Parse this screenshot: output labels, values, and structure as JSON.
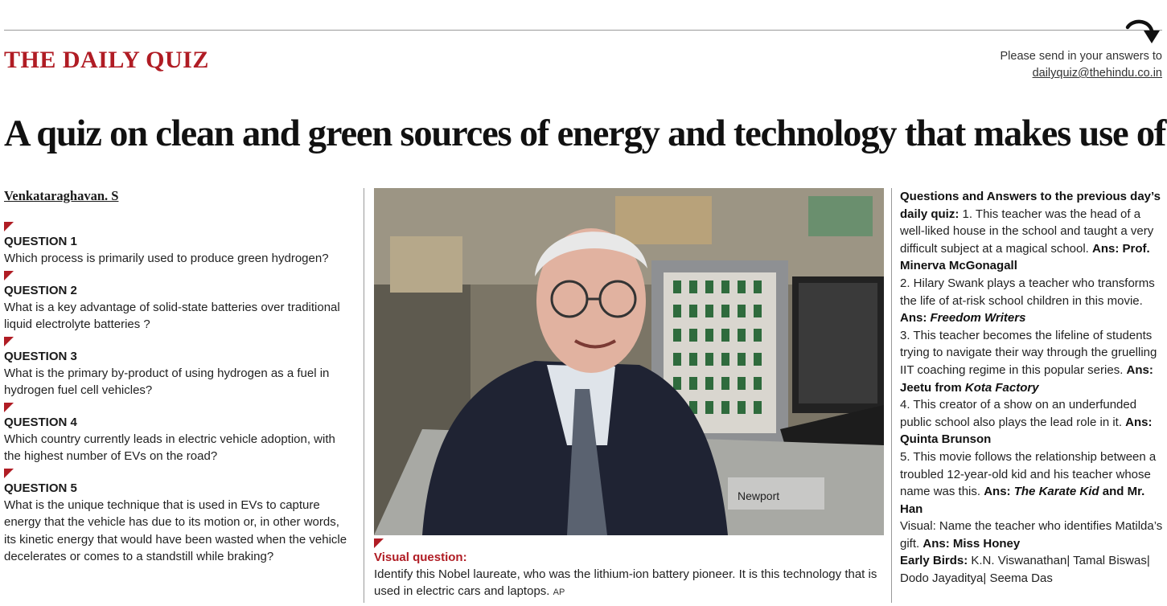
{
  "header": {
    "section_title": "THE DAILY QUIZ",
    "send_note": "Please send in your answers to",
    "email": "dailyquiz@thehindu.co.in"
  },
  "headline": "A quiz on clean and green sources of energy and technology that makes use of it",
  "byline": "Venkataraghavan. S",
  "questions": [
    {
      "label": "QUESTION 1",
      "text": "Which process is primarily used to produce green hydrogen?"
    },
    {
      "label": "QUESTION 2",
      "text": "What is a key advantage of solid-state batteries over traditional liquid electrolyte batteries ?"
    },
    {
      "label": "QUESTION 3",
      "text": "What is the primary by-product of using hydrogen as a fuel in hydrogen fuel cell vehicles?"
    },
    {
      "label": "QUESTION 4",
      "text": "Which country currently leads in electric vehicle adoption, with the highest number of EVs on the road?"
    },
    {
      "label": "QUESTION 5",
      "text": "What is the unique technique that is used in EVs to capture energy that the vehicle has due to its motion or, in other words, its kinetic energy that would have been wasted when the vehicle decelerates or comes to a standstill while braking?"
    }
  ],
  "visual": {
    "label": "Visual question:",
    "text": "Identify this Nobel laureate, who was the lithium-ion battery pioneer. It is this technology that is used in electric cars and laptops.",
    "credit": "AP",
    "photo_text": "Newport"
  },
  "answers": {
    "intro": "Questions and Answers to the previous day’s daily quiz:",
    "items": [
      {
        "q": "1. This teacher was the head of a well-liked house in the school and taught a very difficult subject at a magical school.",
        "ans_prefix": "Ans: Prof. Minerva McGonagall",
        "ans_italic": "",
        "ans_suffix": ""
      },
      {
        "q": "2. Hilary Swank plays a teacher who transforms the life of at-risk school children in this movie.",
        "ans_prefix": "Ans:",
        "ans_italic": "Freedom Writers",
        "ans_suffix": ""
      },
      {
        "q": "3. This teacher becomes the lifeline of students trying to navigate their way through the gruelling IIT coaching regime in this popular series.",
        "ans_prefix": "Ans: Jeetu from",
        "ans_italic": "Kota Factory",
        "ans_suffix": ""
      },
      {
        "q": "4. This creator of a show on an underfunded public school also plays the lead role in it.",
        "ans_prefix": "Ans: Quinta Brunson",
        "ans_italic": "",
        "ans_suffix": ""
      },
      {
        "q": "5. This movie follows the relationship between a troubled 12-year-old kid and his teacher whose name was this.",
        "ans_prefix": "Ans:",
        "ans_italic": "The Karate Kid",
        "ans_suffix": "and Mr. Han"
      },
      {
        "q": "Visual: Name the teacher who identifies Matilda’s gift.",
        "ans_prefix": "Ans: Miss Honey",
        "ans_italic": "",
        "ans_suffix": ""
      }
    ],
    "early_birds_label": "Early Birds:",
    "early_birds": "K.N. Viswanathan| Tamal Biswas| Dodo Jayaditya| Seema Das"
  },
  "colors": {
    "accent": "#b01c24",
    "rule": "#9a9a9a"
  }
}
